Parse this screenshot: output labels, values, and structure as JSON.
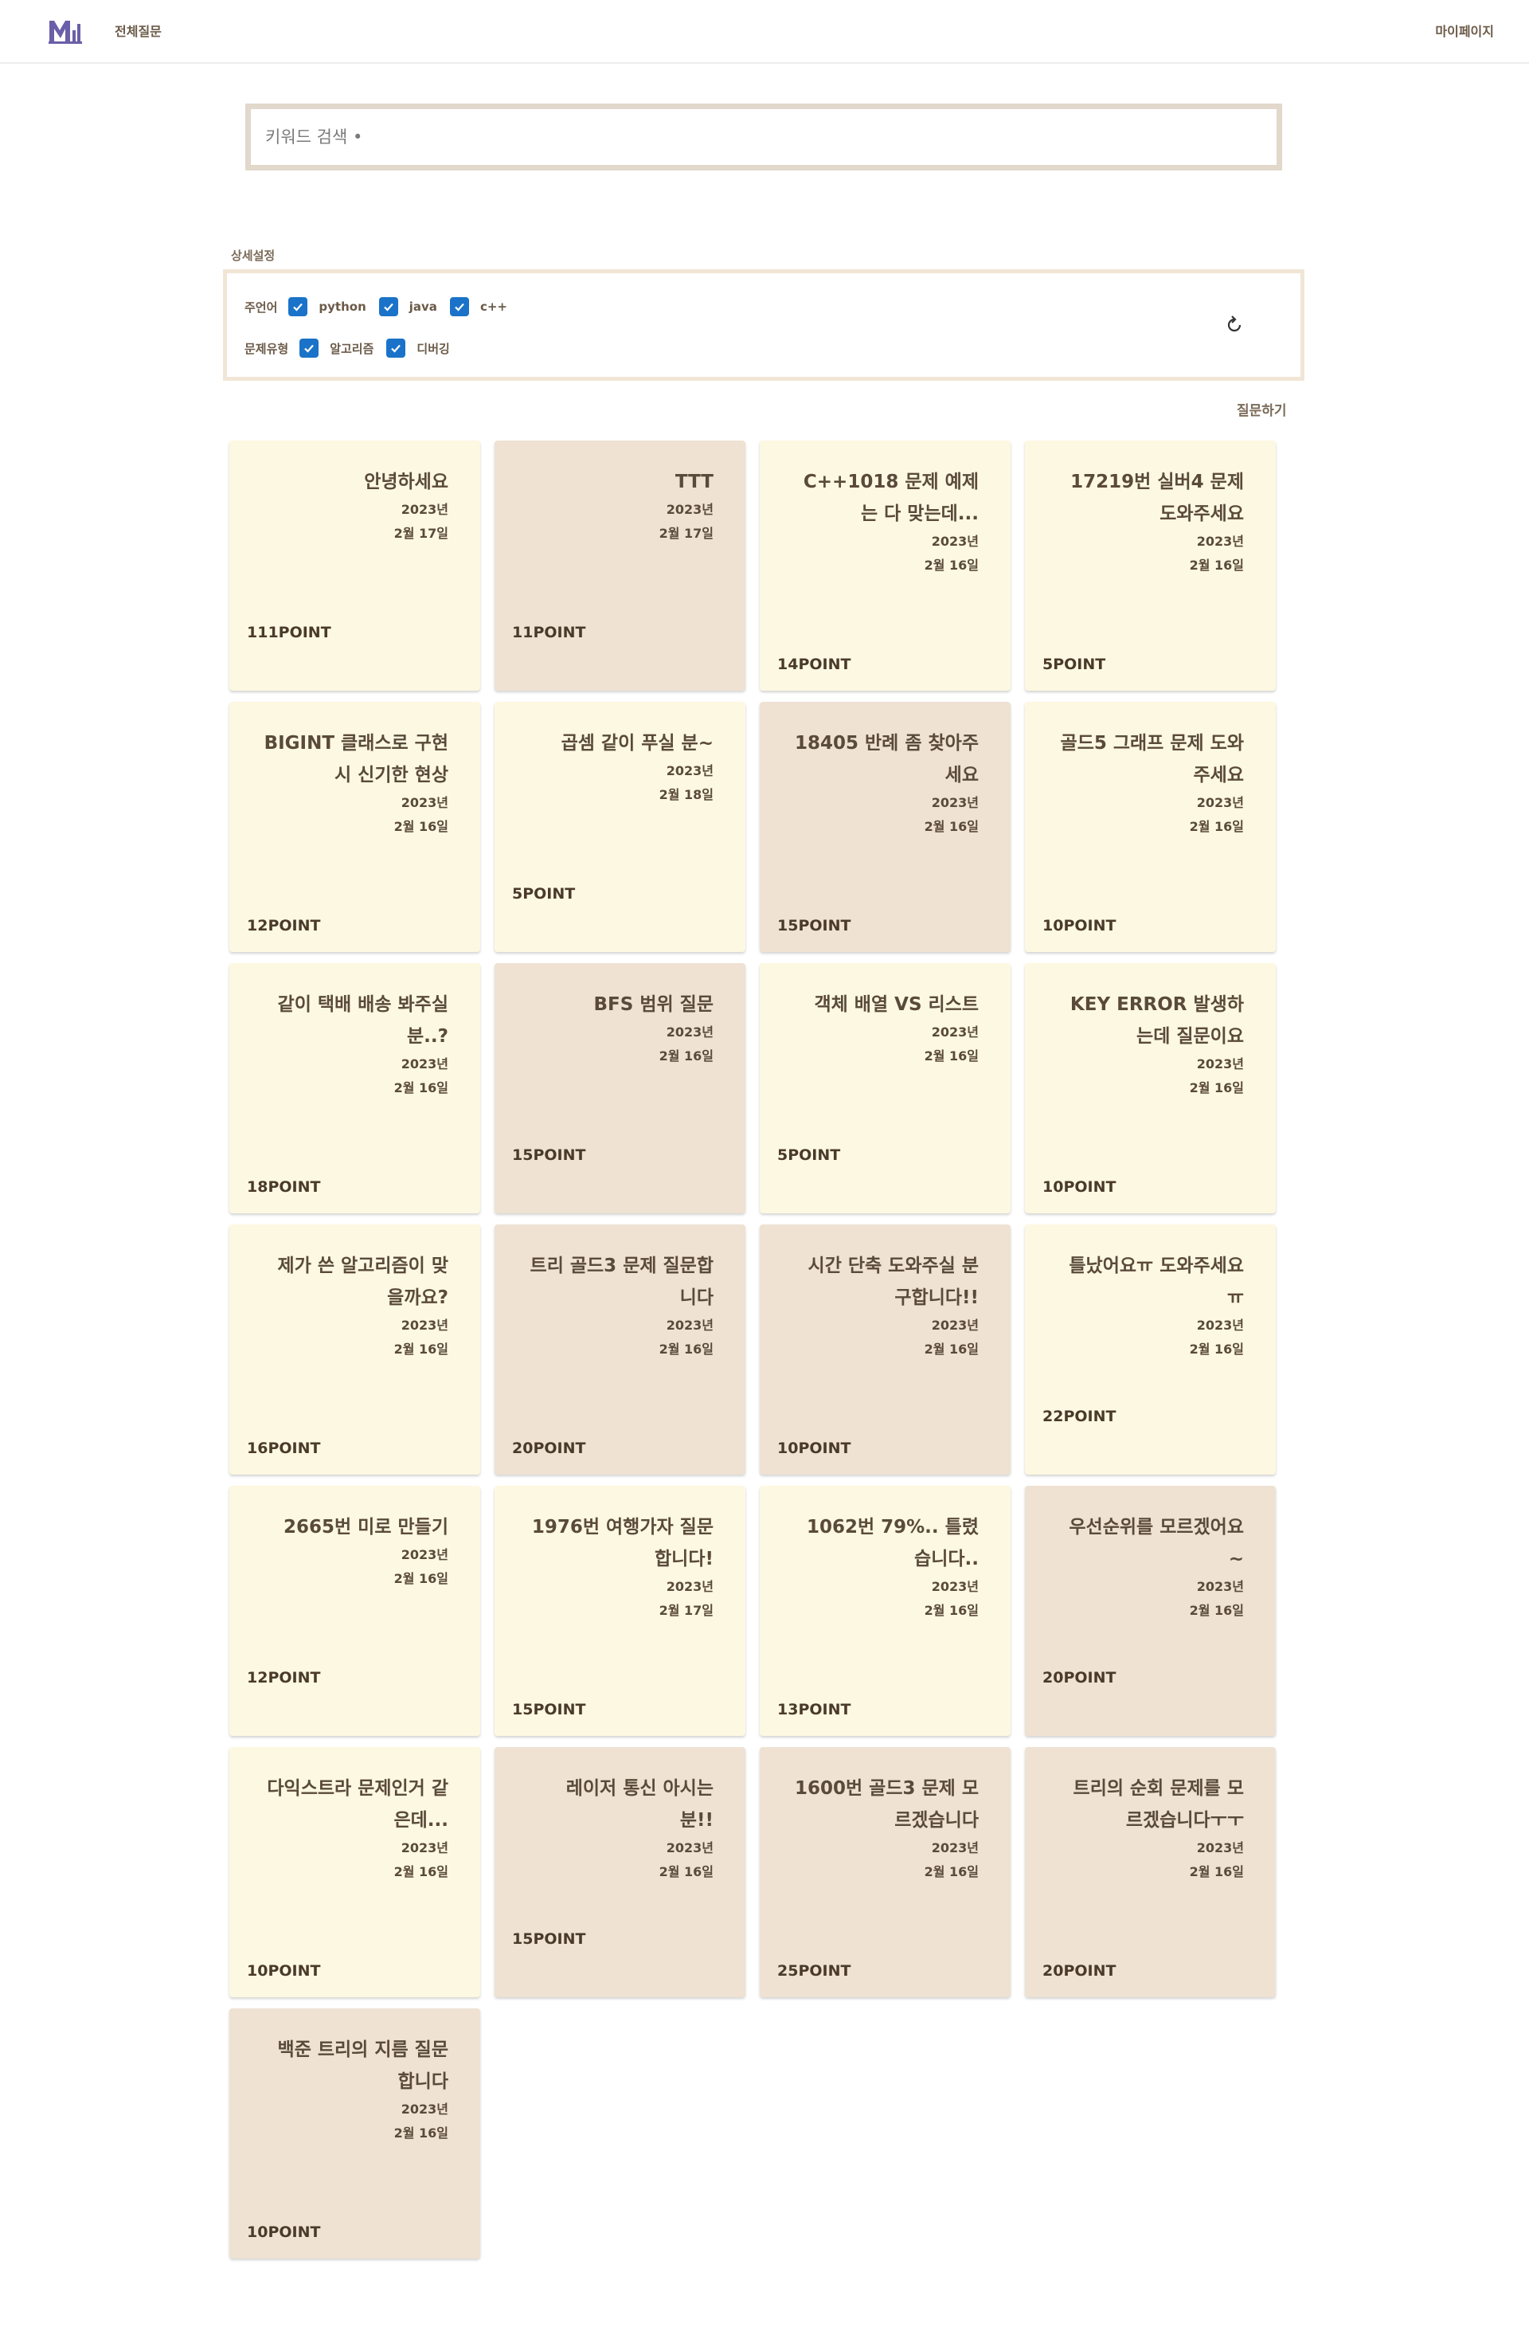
{
  "nav": {
    "all_questions": "전체질문",
    "mypage": "마이페이지"
  },
  "search": {
    "placeholder": "키워드 검색 •"
  },
  "filters": {
    "section_label": "상세설정",
    "language_label": "주언어",
    "languages": [
      "python",
      "java",
      "c++"
    ],
    "type_label": "문제유형",
    "types": [
      "알고리즘",
      "디버깅"
    ],
    "checkbox_color": "#1a73c9"
  },
  "ask_button": "질문하기",
  "colors": {
    "card_light": "#fdf8e1",
    "card_dark": "#efe2d3",
    "logo": "#6a5fa8"
  },
  "cards": [
    {
      "title": "안녕하세요",
      "year": "2023년",
      "date": "2월 17일",
      "points": "111POINT"
    },
    {
      "title": "TTT",
      "year": "2023년",
      "date": "2월 17일",
      "points": "11POINT"
    },
    {
      "title": "C++1018 문제 예제는 다 맞는데...",
      "year": "2023년",
      "date": "2월 16일",
      "points": "14POINT"
    },
    {
      "title": "17219번 실버4 문제 도와주세요",
      "year": "2023년",
      "date": "2월 16일",
      "points": "5POINT"
    },
    {
      "title": "BIGINT 클래스로 구현 시 신기한 현상",
      "year": "2023년",
      "date": "2월 16일",
      "points": "12POINT"
    },
    {
      "title": "곱셈 같이 푸실 분~",
      "year": "2023년",
      "date": "2월 18일",
      "points": "5POINT"
    },
    {
      "title": "18405 반례 좀 찾아주세요",
      "year": "2023년",
      "date": "2월 16일",
      "points": "15POINT"
    },
    {
      "title": "골드5 그래프 문제 도와주세요",
      "year": "2023년",
      "date": "2월 16일",
      "points": "10POINT"
    },
    {
      "title": "같이 택배 배송 봐주실 분..?",
      "year": "2023년",
      "date": "2월 16일",
      "points": "18POINT"
    },
    {
      "title": "BFS 범위 질문",
      "year": "2023년",
      "date": "2월 16일",
      "points": "15POINT"
    },
    {
      "title": "객체 배열 VS 리스트",
      "year": "2023년",
      "date": "2월 16일",
      "points": "5POINT"
    },
    {
      "title": "KEY ERROR 발생하는데 질문이요",
      "year": "2023년",
      "date": "2월 16일",
      "points": "10POINT"
    },
    {
      "title": "제가 쓴 알고리즘이 맞을까요?",
      "year": "2023년",
      "date": "2월 16일",
      "points": "16POINT"
    },
    {
      "title": "트리 골드3 문제 질문합니다",
      "year": "2023년",
      "date": "2월 16일",
      "points": "20POINT"
    },
    {
      "title": "시간 단축 도와주실 분 구합니다!!",
      "year": "2023년",
      "date": "2월 16일",
      "points": "10POINT"
    },
    {
      "title": "틀났어요ㅠ 도와주세요ㅠ",
      "year": "2023년",
      "date": "2월 16일",
      "points": "22POINT"
    },
    {
      "title": "2665번 미로 만들기",
      "year": "2023년",
      "date": "2월 16일",
      "points": "12POINT"
    },
    {
      "title": "1976번 여행가자 질문합니다!",
      "year": "2023년",
      "date": "2월 17일",
      "points": "15POINT"
    },
    {
      "title": "1062번 79%.. 틀렸습니다..",
      "year": "2023년",
      "date": "2월 16일",
      "points": "13POINT"
    },
    {
      "title": "우선순위를 모르겠어요~",
      "year": "2023년",
      "date": "2월 16일",
      "points": "20POINT"
    },
    {
      "title": "다익스트라 문제인거 같은데...",
      "year": "2023년",
      "date": "2월 16일",
      "points": "10POINT"
    },
    {
      "title": "레이저 통신 아시는 분!!",
      "year": "2023년",
      "date": "2월 16일",
      "points": "15POINT"
    },
    {
      "title": "1600번 골드3 문제 모르겠습니다",
      "year": "2023년",
      "date": "2월 16일",
      "points": "25POINT"
    },
    {
      "title": "트리의 순회 문제를 모르겠습니다ㅜㅜ",
      "year": "2023년",
      "date": "2월 16일",
      "points": "20POINT"
    },
    {
      "title": "백준 트리의 지름 질문합니다",
      "year": "2023년",
      "date": "2월 16일",
      "points": "10POINT"
    }
  ]
}
